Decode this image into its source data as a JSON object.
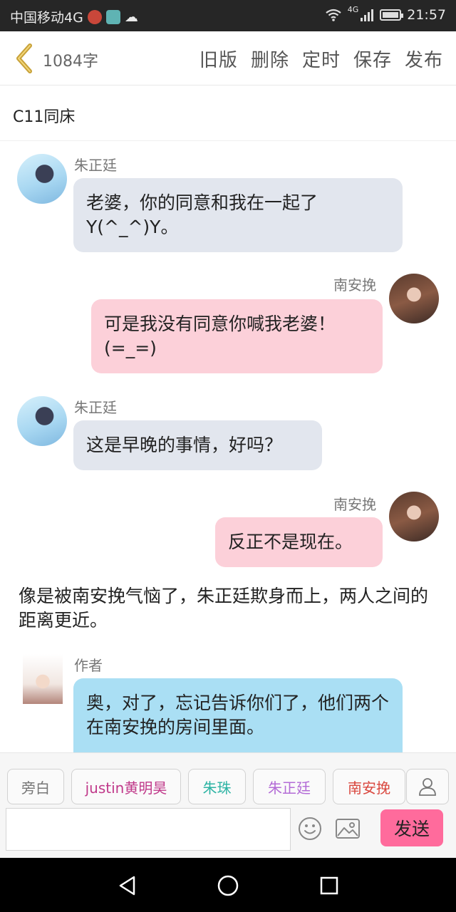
{
  "status_bar": {
    "carrier": "中国移动4G",
    "network": "4G",
    "time": "21:57"
  },
  "header": {
    "word_count": "1084字",
    "actions": [
      "旧版",
      "删除",
      "定时",
      "保存",
      "发布"
    ]
  },
  "chapter": {
    "title": "C11同床"
  },
  "messages": [
    {
      "sender": "朱正廷",
      "side": "left",
      "text": "老婆，你的同意和我在一起了Y(^_^)Y。"
    },
    {
      "sender": "南安挽",
      "side": "right",
      "text": "可是我没有同意你喊我老婆！(=_=)"
    },
    {
      "sender": "朱正廷",
      "side": "left",
      "text": "这是早晚的事情，好吗？"
    },
    {
      "sender": "南安挽",
      "side": "right",
      "text": "反正不是现在。"
    },
    {
      "sender": "作者",
      "side": "left",
      "text": "奥，对了，忘记告诉你们了，他们两个在南安挽的房间里面。"
    }
  ],
  "narration": "像是被南安挽气恼了，朱正廷欺身而上，两人之间的距离更近。",
  "roles": [
    {
      "label": "旁白",
      "color": "#777777"
    },
    {
      "label": "justin黄明昊",
      "color": "#c0398a"
    },
    {
      "label": "朱珠",
      "color": "#2bb3a3"
    },
    {
      "label": "朱正廷",
      "color": "#b36bd6"
    },
    {
      "label": "南安挽",
      "color": "#d9463d"
    }
  ],
  "input": {
    "placeholder": "",
    "send_label": "发送"
  },
  "colors": {
    "accent": "#ff6b9c",
    "bubble_left": "#e2e6ee",
    "bubble_right": "#fcd0d9",
    "bubble_author": "#aadff4",
    "back_arrow": "#c8a23a"
  }
}
